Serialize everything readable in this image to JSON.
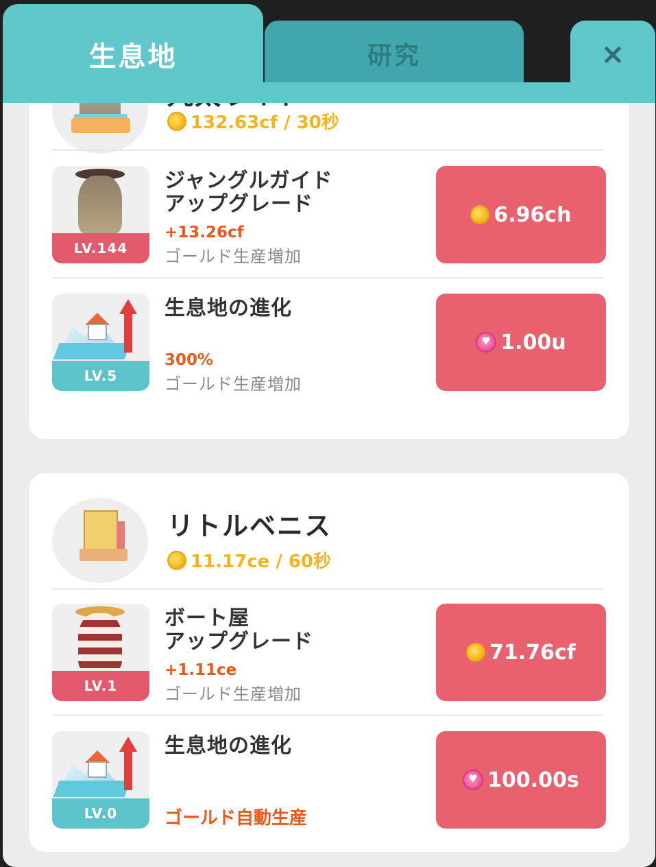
{
  "tabs": {
    "habitat": "生息地",
    "research": "研究",
    "close": "×"
  },
  "habitats": [
    {
      "title": "丸太ライド",
      "rate": "132.63cf / 30秒",
      "items": [
        {
          "name_line1": "ジャングルガイド",
          "name_line2": "アップグレード",
          "level": "LV.144",
          "effect": "+13.26cf",
          "desc": "ゴールド生産増加",
          "cost": "6.96ch",
          "currency": "coin-icon"
        },
        {
          "name_line1": "生息地の進化",
          "level": "LV.5",
          "effect": "300%",
          "desc": "ゴールド生産増加",
          "cost": "1.00u",
          "currency": "gem-icon"
        }
      ]
    },
    {
      "title": "リトルベニス",
      "rate": "11.17ce / 60秒",
      "items": [
        {
          "name_line1": "ボート屋",
          "name_line2": "アップグレード",
          "level": "LV.1",
          "effect": "+1.11ce",
          "desc": "ゴールド生産増加",
          "cost": "71.76cf",
          "currency": "coin-icon"
        },
        {
          "name_line1": "生息地の進化",
          "level": "LV.0",
          "effect": "ゴールド自動生産",
          "cost": "100.00s",
          "currency": "gem-icon"
        }
      ]
    }
  ],
  "colors": {
    "tab_active": "#60c7cb",
    "tab_inactive": "#41a7ad",
    "buy_button": "#e9606e",
    "coin": "#f2b51d",
    "effect": "#e8591e"
  }
}
